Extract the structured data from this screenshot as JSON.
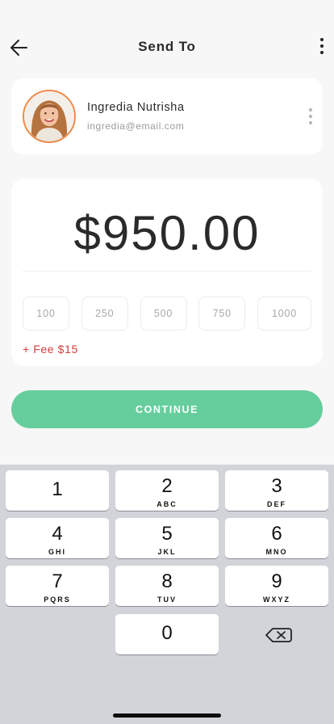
{
  "header": {
    "title": "Send To",
    "back_icon": "arrow-left-icon",
    "more_icon": "more-vertical-icon"
  },
  "recipient": {
    "name": "Ingredia Nutrisha",
    "email": "ingredia@email.com",
    "avatar_icon": "avatar",
    "ring_color": "#ee8a4a"
  },
  "amount": {
    "value": "$950.00"
  },
  "presets": [
    "100",
    "250",
    "500",
    "750",
    "1000"
  ],
  "fee": "+ Fee $15",
  "continue": {
    "label": "CONTINUE",
    "color": "#66ce9d"
  },
  "keypad": {
    "keys": [
      {
        "num": "1",
        "letters": ""
      },
      {
        "num": "2",
        "letters": "ABC"
      },
      {
        "num": "3",
        "letters": "DEF"
      },
      {
        "num": "4",
        "letters": "GHI"
      },
      {
        "num": "5",
        "letters": "JKL"
      },
      {
        "num": "6",
        "letters": "MNO"
      },
      {
        "num": "7",
        "letters": "PQRS"
      },
      {
        "num": "8",
        "letters": "TUV"
      },
      {
        "num": "9",
        "letters": "WXYZ"
      },
      {
        "num": "0",
        "letters": ""
      }
    ],
    "delete_icon": "backspace-icon"
  },
  "colors": {
    "accent": "#66ce9d",
    "fee": "#d2403f",
    "background": "#f7f7f7"
  }
}
